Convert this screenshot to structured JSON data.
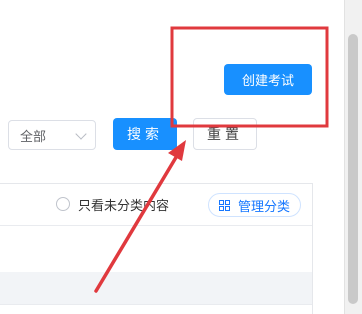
{
  "header": {
    "create_button_label": "创建考试"
  },
  "filters": {
    "scope_select_value": "全部",
    "search_button_label": "搜索",
    "reset_button_label": "重置"
  },
  "table_toolbar": {
    "only_unclassified_label": "只看未分类内容",
    "manage_categories_label": "管理分类"
  },
  "icons": {
    "select_chevron": "chevron-down-icon",
    "radio": "radio-icon",
    "manage_categories": "grid-icon"
  },
  "colors": {
    "primary": "#1890ff",
    "annotation_red": "#e0393e"
  }
}
